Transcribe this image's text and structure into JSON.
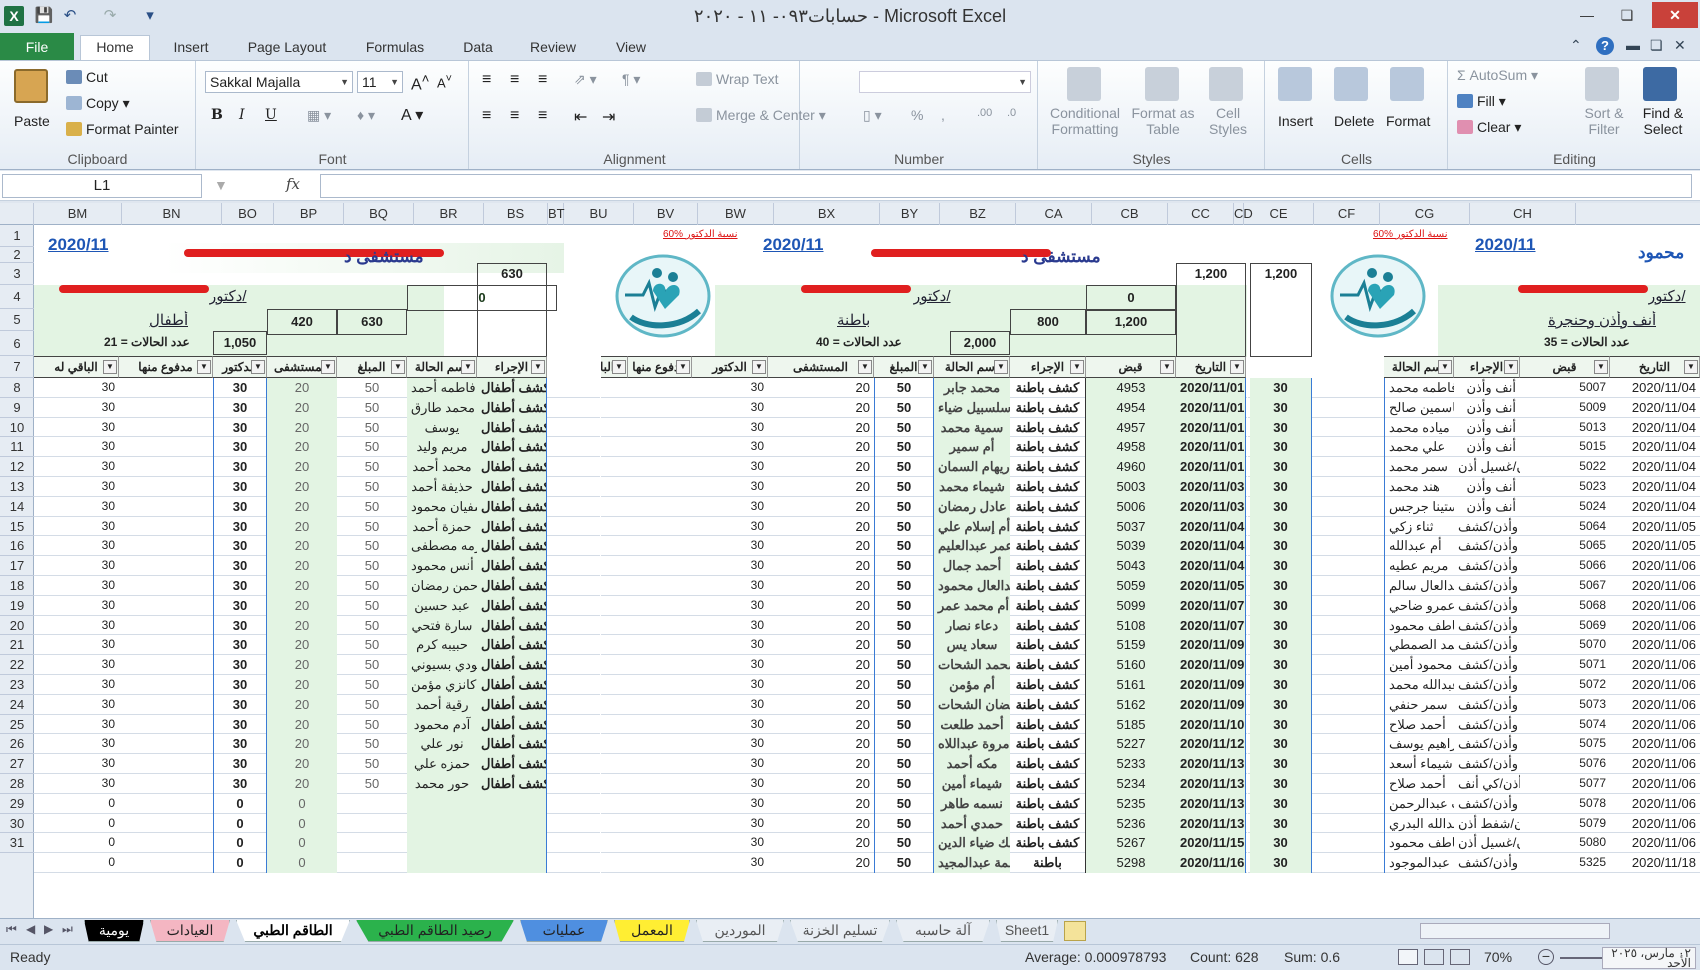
{
  "window": {
    "title": "حسابات٠٩٣- ١١ - ٢٠٢٠ - Microsoft Excel"
  },
  "ribbon_tabs": [
    "File",
    "Home",
    "Insert",
    "Page Layout",
    "Formulas",
    "Data",
    "Review",
    "View"
  ],
  "clipboard": {
    "paste": "Paste",
    "cut": "Cut",
    "copy": "Copy",
    "format_painter": "Format Painter",
    "label": "Clipboard"
  },
  "font": {
    "name": "Sakkal Majalla",
    "size": "11",
    "label": "Font"
  },
  "alignment": {
    "wrap": "Wrap Text",
    "merge": "Merge & Center",
    "label": "Alignment"
  },
  "number": {
    "label": "Number"
  },
  "styles": {
    "cond": "Conditional Formatting",
    "table": "Format as Table",
    "cell": "Cell Styles",
    "label": "Styles"
  },
  "cells_grp": {
    "insert": "Insert",
    "delete": "Delete",
    "format": "Format",
    "label": "Cells"
  },
  "editing": {
    "autosum": "AutoSum",
    "fill": "Fill",
    "clear": "Clear",
    "sort": "Sort & Filter",
    "find": "Find & Select",
    "label": "Editing"
  },
  "formula_bar": {
    "name_box": "L1",
    "fx": "fx",
    "formula": ""
  },
  "columns": [
    "BM",
    "BN",
    "BO",
    "BP",
    "BQ",
    "BR",
    "BS",
    "BT",
    "BU",
    "BV",
    "BW",
    "BX",
    "BY",
    "BZ",
    "CA",
    "CB",
    "CC",
    "CD",
    "CE",
    "CF",
    "CG",
    "CH"
  ],
  "rows": [
    "1",
    "2",
    "3",
    "4",
    "5",
    "6",
    "7",
    "8",
    "9",
    "10",
    "11",
    "12",
    "13",
    "14",
    "15",
    "16",
    "17",
    "18",
    "19",
    "20",
    "21",
    "22",
    "23",
    "24",
    "25",
    "26",
    "27",
    "28",
    "29",
    "30",
    "31"
  ],
  "panel1": {
    "date": "2020/11",
    "hospital": "مستشفى د",
    "doctor": "دكتور/",
    "dept": "أطفال",
    "cases": "عدد الحالات = 21",
    "r3_zero": "0",
    "r2_total": "630",
    "r4_a": "420",
    "r4_b": "630",
    "r5_total": "1,050",
    "headers": [
      "الإجراء",
      "إسم الحالة",
      "المبلغ",
      "المستشفى",
      "الدكتور",
      "مدفوع منها",
      "الباقي له"
    ],
    "rows": [
      [
        "كشف أطفال",
        "فاطمه أحمد",
        "50",
        "20",
        "30",
        "",
        "30"
      ],
      [
        "كشف أطفال",
        "محمد طارق",
        "50",
        "20",
        "30",
        "",
        "30"
      ],
      [
        "كشف أطفال",
        "يوسف",
        "50",
        "20",
        "30",
        "",
        "30"
      ],
      [
        "كشف أطفال",
        "مريم وليد",
        "50",
        "20",
        "30",
        "",
        "30"
      ],
      [
        "كشف أطفال",
        "محمد أحمد",
        "50",
        "20",
        "30",
        "",
        "30"
      ],
      [
        "كشف أطفال",
        "حذيفة أحمد",
        "50",
        "20",
        "30",
        "",
        "30"
      ],
      [
        "كشف أطفال",
        "سفيان محمود",
        "50",
        "20",
        "30",
        "",
        "30"
      ],
      [
        "كشف أطفال",
        "حمزة أحمد",
        "50",
        "20",
        "30",
        "",
        "30"
      ],
      [
        "كشف أطفال",
        "كرمه مصطفى",
        "50",
        "20",
        "30",
        "",
        "30"
      ],
      [
        "كشف أطفال",
        "أنس محمود",
        "50",
        "20",
        "30",
        "",
        "30"
      ],
      [
        "كشف أطفال",
        "عبدالرحمن رمضان",
        "50",
        "20",
        "30",
        "",
        "30"
      ],
      [
        "كشف أطفال",
        "عبد حسين",
        "50",
        "20",
        "30",
        "",
        "30"
      ],
      [
        "كشف أطفال",
        "سارة فتحي",
        "50",
        "20",
        "30",
        "",
        "30"
      ],
      [
        "كشف أطفال",
        "حبيبه كرم",
        "50",
        "20",
        "30",
        "",
        "30"
      ],
      [
        "كشف أطفال",
        "جودي بسيوني",
        "50",
        "20",
        "30",
        "",
        "30"
      ],
      [
        "كشف أطفال",
        "كانزي مؤمن",
        "50",
        "20",
        "30",
        "",
        "30"
      ],
      [
        "كشف أطفال",
        "رقية أحمد",
        "50",
        "20",
        "30",
        "",
        "30"
      ],
      [
        "كشف أطفال",
        "آدم محمود",
        "50",
        "20",
        "30",
        "",
        "30"
      ],
      [
        "كشف أطفال",
        "نور علي",
        "50",
        "20",
        "30",
        "",
        "30"
      ],
      [
        "كشف أطفال",
        "حمزه علي",
        "50",
        "20",
        "30",
        "",
        "30"
      ],
      [
        "كشف أطفال",
        "حور محمد",
        "50",
        "20",
        "30",
        "",
        "30"
      ],
      [
        "",
        "",
        "",
        "0",
        "0",
        "",
        "0"
      ],
      [
        "",
        "",
        "",
        "0",
        "0",
        "",
        "0"
      ],
      [
        "",
        "",
        "",
        "0",
        "0",
        "",
        "0"
      ],
      [
        "",
        "",
        "",
        "0",
        "0",
        "",
        "0"
      ]
    ]
  },
  "panel2": {
    "date": "2020/11",
    "pct": "60% نسبة الدكتور",
    "hospital": "مستشفى د",
    "doctor": "دكتور/",
    "dept": "باطنة",
    "cases": "عدد الحالات = 40",
    "r2_total": "1,200",
    "r3_zero": "0",
    "r4_a": "800",
    "r4_b": "1,200",
    "r5_total": "2,000",
    "headers": [
      "التاريخ",
      "قبض",
      "الإجراء",
      "إسم الحالة",
      "المبلغ",
      "المستشفى",
      "الدكتور",
      "مدفوع منها",
      "الباقي له"
    ],
    "rows": [
      [
        "2020/11/01",
        "4953",
        "كشف باطنة",
        "محمد جابر",
        "50",
        "20",
        "30",
        "",
        "30"
      ],
      [
        "2020/11/01",
        "4954",
        "كشف باطنة",
        "سلسبيل ضياء",
        "50",
        "20",
        "30",
        "",
        "30"
      ],
      [
        "2020/11/01",
        "4957",
        "كشف باطنة",
        "سمية محمد",
        "50",
        "20",
        "30",
        "",
        "30"
      ],
      [
        "2020/11/01",
        "4958",
        "كشف باطنة",
        "أم سمير",
        "50",
        "20",
        "30",
        "",
        "30"
      ],
      [
        "2020/11/01",
        "4960",
        "كشف باطنة",
        "ريهام السمان",
        "50",
        "20",
        "30",
        "",
        "30"
      ],
      [
        "2020/11/03",
        "5003",
        "كشف باطنة",
        "شيماء محمد",
        "50",
        "20",
        "30",
        "",
        "30"
      ],
      [
        "2020/11/03",
        "5006",
        "كشف باطنة",
        "عادل رمضان",
        "50",
        "20",
        "30",
        "",
        "30"
      ],
      [
        "2020/11/04",
        "5037",
        "كشف باطنة",
        "أم إسلام علي",
        "50",
        "20",
        "30",
        "",
        "30"
      ],
      [
        "2020/11/04",
        "5039",
        "كشف باطنة",
        "عمر عبدالعليم",
        "50",
        "20",
        "30",
        "",
        "30"
      ],
      [
        "2020/11/04",
        "5043",
        "كشف باطنة",
        "أحمد جمال",
        "50",
        "20",
        "30",
        "",
        "30"
      ],
      [
        "2020/11/05",
        "5059",
        "كشف باطنة",
        "عبدالعال محمود",
        "50",
        "20",
        "30",
        "",
        "30"
      ],
      [
        "2020/11/07",
        "5099",
        "كشف باطنة",
        "أم محمد عمر",
        "50",
        "20",
        "30",
        "",
        "30"
      ],
      [
        "2020/11/07",
        "5108",
        "كشف باطنة",
        "دعاء نصار",
        "50",
        "20",
        "30",
        "",
        "30"
      ],
      [
        "2020/11/09",
        "5159",
        "كشف باطنة",
        "سعاد يس",
        "50",
        "20",
        "30",
        "",
        "30"
      ],
      [
        "2020/11/09",
        "5160",
        "كشف باطنة",
        "محمد الشحات",
        "50",
        "20",
        "30",
        "",
        "30"
      ],
      [
        "2020/11/09",
        "5161",
        "كشف باطنة",
        "أم مؤمن",
        "50",
        "20",
        "30",
        "",
        "30"
      ],
      [
        "2020/11/09",
        "5162",
        "كشف باطنة",
        "رمضان الشحات",
        "50",
        "20",
        "30",
        "",
        "30"
      ],
      [
        "2020/11/10",
        "5185",
        "كشف باطنة",
        "أحمد طلعت",
        "50",
        "20",
        "30",
        "",
        "30"
      ],
      [
        "2020/11/12",
        "5227",
        "كشف باطنة",
        "مروة عبداللاه",
        "50",
        "20",
        "30",
        "",
        "30"
      ],
      [
        "2020/11/13",
        "5233",
        "كشف باطنة",
        "مكه أحمد",
        "50",
        "20",
        "30",
        "",
        "30"
      ],
      [
        "2020/11/13",
        "5234",
        "كشف باطنة",
        "شيماء أمين",
        "50",
        "20",
        "30",
        "",
        "30"
      ],
      [
        "2020/11/13",
        "5235",
        "كشف باطنة",
        "نسمه طاهر",
        "50",
        "20",
        "30",
        "",
        "30"
      ],
      [
        "2020/11/13",
        "5236",
        "كشف باطنة",
        "حمدي أحمد",
        "50",
        "20",
        "30",
        "",
        "30"
      ],
      [
        "2020/11/15",
        "5267",
        "كشف باطنة",
        "مالك ضياء الدين",
        "50",
        "20",
        "30",
        "",
        "30"
      ],
      [
        "2020/11/16",
        "5298",
        "باطنة",
        "فاطمة عبدالمجيد",
        "50",
        "20",
        "30",
        "",
        "30"
      ]
    ]
  },
  "panel3": {
    "date": "2020/11",
    "pct": "60% نسبة الدكتور",
    "name": "محمود",
    "doctor": "دكتور/",
    "dept": "أنف وأذن وحنجرة",
    "cases": "عدد الحالات = 35",
    "r2_total": "1,200",
    "headers": [
      "التاريخ",
      "قبض",
      "الإجراء",
      "إسم الحالة"
    ],
    "rows": [
      [
        "2020/11/04",
        "5007",
        "أنف وأذن",
        "فاطمه محمد"
      ],
      [
        "2020/11/04",
        "5009",
        "أنف وأذن",
        "ياسمين صالح"
      ],
      [
        "2020/11/04",
        "5013",
        "أنف وأذن",
        "مياده محمد"
      ],
      [
        "2020/11/04",
        "5015",
        "أنف وأذن",
        "علي محمد"
      ],
      [
        "2020/11/04",
        "5022",
        "أنف وأذن/غسيل أذن",
        "سمر محمد"
      ],
      [
        "2020/11/04",
        "5023",
        "أنف وأذن",
        "هند محمد"
      ],
      [
        "2020/11/04",
        "5024",
        "أنف وأذن",
        "يوستينا جرجس"
      ],
      [
        "2020/11/05",
        "5064",
        "أنف وأذن/كشف",
        "ثناء زكي"
      ],
      [
        "2020/11/05",
        "5065",
        "أنف وأذن/كشف",
        "أم عبدالله"
      ],
      [
        "2020/11/06",
        "5066",
        "أنف وأذن/كشف",
        "مريم عطيه"
      ],
      [
        "2020/11/06",
        "5067",
        "أنف وأذن/كشف",
        "عبدالعال سالم"
      ],
      [
        "2020/11/06",
        "5068",
        "أنف وأذن/كشف",
        "عمرو ضاحي"
      ],
      [
        "2020/11/06",
        "5069",
        "أنف وأذن/كشف",
        "عاطف محمود"
      ],
      [
        "2020/11/06",
        "5070",
        "أنف وأذن/كشف",
        "أحمد الصمطي"
      ],
      [
        "2020/11/06",
        "5071",
        "أنف وأذن/كشف",
        "محمود أمين"
      ],
      [
        "2020/11/06",
        "5072",
        "أنف وأذن/كشف",
        "أم عبدالله محمد"
      ],
      [
        "2020/11/06",
        "5073",
        "أنف وأذن/كشف",
        "سمر حنفي"
      ],
      [
        "2020/11/06",
        "5074",
        "أنف وأذن/كشف",
        "أحمد صلاح"
      ],
      [
        "2020/11/06",
        "5075",
        "أنف وأذن/كشف",
        "إبراهيم يوسف"
      ],
      [
        "2020/11/06",
        "5076",
        "أنف وأذن/كشف",
        "شيماء أسعد"
      ],
      [
        "2020/11/06",
        "5077",
        "أنف وأذن/كي أنف",
        "أحمد صلاح"
      ],
      [
        "2020/11/06",
        "5078",
        "أنف وأذن/كشف",
        "جنات عبدالرحمن"
      ],
      [
        "2020/11/06",
        "5079",
        "أنف وأذن/شفط أذن",
        "أم عبدالله البدري"
      ],
      [
        "2020/11/06",
        "5080",
        "أنف وأذن/غسيل أذن",
        "عاطف محمود"
      ],
      [
        "2020/11/18",
        "5325",
        "أنف وأذن/كشف",
        "بخيته عبدالموجود"
      ]
    ]
  },
  "sheet_tabs": [
    {
      "label": "يومية",
      "color": "#000000",
      "text": "#ffffff"
    },
    {
      "label": "العيادات",
      "color": "#f4b6c2",
      "text": "#222222"
    },
    {
      "label": "الطاقم الطبي",
      "color": "#ffffff",
      "text": "#000000"
    },
    {
      "label": "رصيد الطاقم الطبي",
      "color": "#2bb24c",
      "text": "#222222"
    },
    {
      "label": "عمليات",
      "color": "#4f8fe0",
      "text": "#222222"
    },
    {
      "label": "المعمل",
      "color": "#ffee33",
      "text": "#222222"
    },
    {
      "label": "الموردين",
      "color": "#e9eef4",
      "text": "#555555"
    },
    {
      "label": "تسليم الخزنة",
      "color": "#e9eef4",
      "text": "#555555"
    },
    {
      "label": "آلة حاسبه",
      "color": "#e9eef4",
      "text": "#555555"
    },
    {
      "label": "Sheet1",
      "color": "#e9eef4",
      "text": "#555555"
    }
  ],
  "status": {
    "ready": "Ready",
    "average": "Average: 0.000978793",
    "count": "Count: 628",
    "sum": "Sum: 0.6",
    "zoom": "70%",
    "datetime": "٠٢ مارس، ٢٠٢٥",
    "day": "الأحد"
  }
}
